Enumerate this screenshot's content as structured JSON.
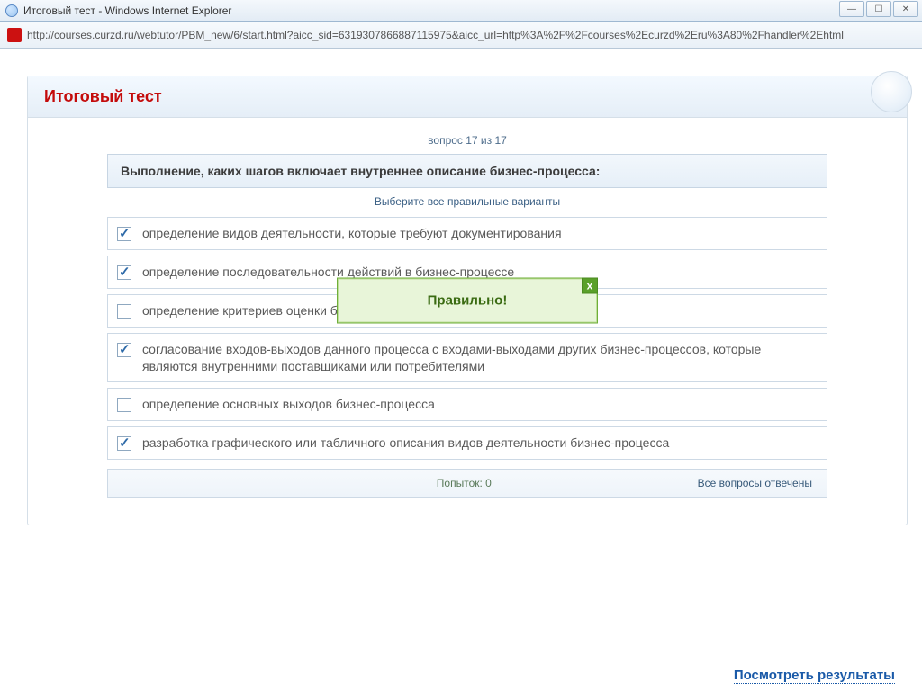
{
  "window": {
    "title": "Итоговый тест - Windows Internet Explorer",
    "min_label": "—",
    "max_label": "☐",
    "close_label": "✕"
  },
  "address_bar": {
    "favicon_letter": "⬤",
    "url": "http://courses.curzd.ru/webtutor/PBM_new/6/start.html?aicc_sid=6319307866887115975&aicc_url=http%3A%2F%2Fcourses%2Ecurzd%2Eru%3A80%2Fhandler%2Ehtml"
  },
  "card": {
    "title": "Итоговый тест",
    "progress": "вопрос 17 из 17"
  },
  "question": {
    "text": "Выполнение, каких шагов включает внутреннее описание бизнес-процесса:",
    "instruction": "Выберите все правильные варианты",
    "options": [
      {
        "checked": true,
        "text": "определение видов деятельности, которые требуют документирования"
      },
      {
        "checked": true,
        "text": "определение последовательности действий в бизнес-процессе"
      },
      {
        "checked": false,
        "text": "определение критериев оценки бизнес-процесса (показателей деятельности)"
      },
      {
        "checked": true,
        "text": "согласование входов-выходов данного процесса с входами-выходами других бизнес-процессов, которые являются внутренними поставщиками или потребителями"
      },
      {
        "checked": false,
        "text": "определение основных выходов бизнес-процесса"
      },
      {
        "checked": true,
        "text": "разработка графического или табличного описания видов деятельности бизнес-процесса"
      }
    ]
  },
  "footer": {
    "attempts": "Попыток: 0",
    "status": "Все вопросы отвечены"
  },
  "popup": {
    "message": "Правильно!",
    "close_label": "x"
  },
  "results_link": "Посмотреть результаты"
}
